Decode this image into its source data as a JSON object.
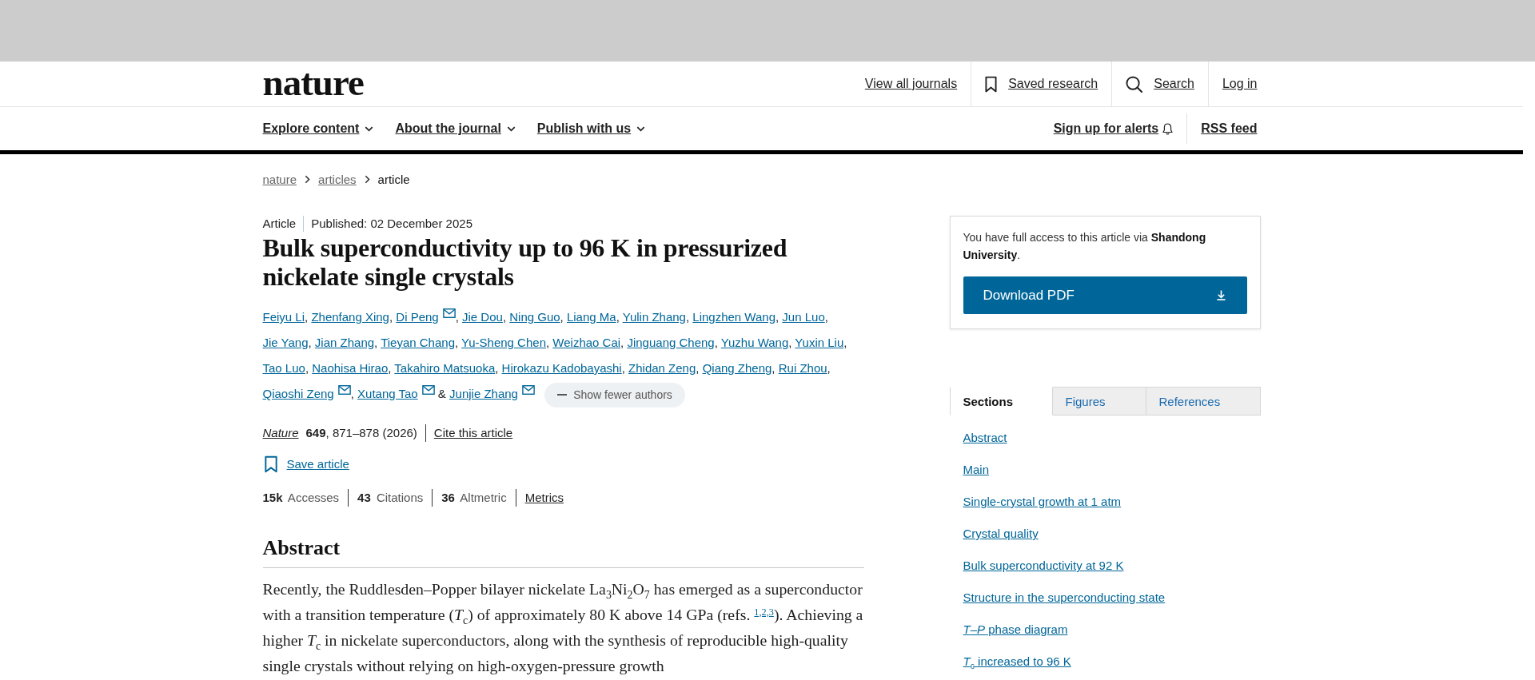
{
  "header": {
    "logo": "nature",
    "links": [
      {
        "kind": "text",
        "label": "View all journals"
      },
      {
        "kind": "bookmark",
        "label": "Saved research"
      },
      {
        "kind": "search",
        "label": "Search"
      },
      {
        "kind": "text",
        "label": "Log in"
      }
    ]
  },
  "nav": {
    "menus": [
      "Explore content",
      "About the journal",
      "Publish with us"
    ],
    "alerts": "Sign up for alerts",
    "rss": "RSS feed"
  },
  "breadcrumb": [
    {
      "label": "nature",
      "current": false
    },
    {
      "label": "articles",
      "current": false
    },
    {
      "label": "article",
      "current": true
    }
  ],
  "article": {
    "type": "Article",
    "published": "Published: 02 December 2025",
    "title": "Bulk superconductivity up to 96 K in pressurized nickelate single crystals",
    "authors": [
      {
        "name": "Feiyu Li",
        "email": false,
        "after": ","
      },
      {
        "name": "Zhenfang Xing",
        "email": false,
        "after": ","
      },
      {
        "name": "Di Peng",
        "email": true,
        "after": ","
      },
      {
        "name": "Jie Dou",
        "email": false,
        "after": ","
      },
      {
        "name": "Ning Guo",
        "email": false,
        "after": ","
      },
      {
        "name": "Liang Ma",
        "email": false,
        "after": ","
      },
      {
        "name": "Yulin Zhang",
        "email": false,
        "after": ","
      },
      {
        "name": "Lingzhen Wang",
        "email": false,
        "after": ","
      },
      {
        "name": "Jun Luo",
        "email": false,
        "after": ","
      },
      {
        "name": "Jie Yang",
        "email": false,
        "after": ","
      },
      {
        "name": "Jian Zhang",
        "email": false,
        "after": ","
      },
      {
        "name": "Tieyan Chang",
        "email": false,
        "after": ","
      },
      {
        "name": "Yu-Sheng Chen",
        "email": false,
        "after": ","
      },
      {
        "name": "Weizhao Cai",
        "email": false,
        "after": ","
      },
      {
        "name": "Jinguang Cheng",
        "email": false,
        "after": ","
      },
      {
        "name": "Yuzhu Wang",
        "email": false,
        "after": ","
      },
      {
        "name": "Yuxin Liu",
        "email": false,
        "after": ","
      },
      {
        "name": "Tao Luo",
        "email": false,
        "after": ","
      },
      {
        "name": "Naohisa Hirao",
        "email": false,
        "after": ","
      },
      {
        "name": "Takahiro Matsuoka",
        "email": false,
        "after": ","
      },
      {
        "name": "Hirokazu Kadobayashi",
        "email": false,
        "after": ","
      },
      {
        "name": "Zhidan Zeng",
        "email": false,
        "after": ","
      },
      {
        "name": "Qiang Zheng",
        "email": false,
        "after": ","
      },
      {
        "name": "Rui Zhou",
        "email": false,
        "after": ","
      },
      {
        "name": "Qiaoshi Zeng",
        "email": true,
        "after": ","
      },
      {
        "name": "Xutang Tao",
        "email": true,
        "after": " &"
      },
      {
        "name": "Junjie Zhang",
        "email": true
      }
    ],
    "authors_toggle": "Show fewer authors",
    "journal": "Nature",
    "citation": "**649**, 871–878 (2026)",
    "cite_link": "Cite this article",
    "save": "Save article",
    "metrics": [
      "**15k** Accesses",
      "**43** Citations",
      "**36** Altmetric"
    ],
    "metrics_link": "Metrics"
  },
  "abstract": {
    "heading": "Abstract",
    "text_before": "Recently, the Ruddlesden–Popper bilayer nickelate La$_{3}$Ni$_{2}$O$_{7}$ has emerged as a superconductor with a transition temperature (*T*$_{c}$) of approximately 80 K above 14 GPa (refs. ",
    "refs": "1,2,3",
    "text_after": "). Achieving a higher *T*$_{c}$ in nickelate superconductors, along with the synthesis of reproducible high-quality single crystals without relying on high-oxygen-pressure growth"
  },
  "sidebar": {
    "access_text": "You have full access to this article via **Shandong University**.",
    "download": "Download PDF",
    "tabs": [
      {
        "label": "Sections",
        "selected": true
      },
      {
        "label": "Figures",
        "selected": false
      },
      {
        "label": "References",
        "selected": false
      }
    ],
    "sections": [
      "Abstract",
      "Main",
      "Single-crystal growth at 1 atm",
      "Crystal quality",
      "Bulk superconductivity at 92 K",
      "Structure in the superconducting state",
      "*T*–*P* phase diagram",
      "*T*$_{c}$ increased to 96 K"
    ]
  }
}
